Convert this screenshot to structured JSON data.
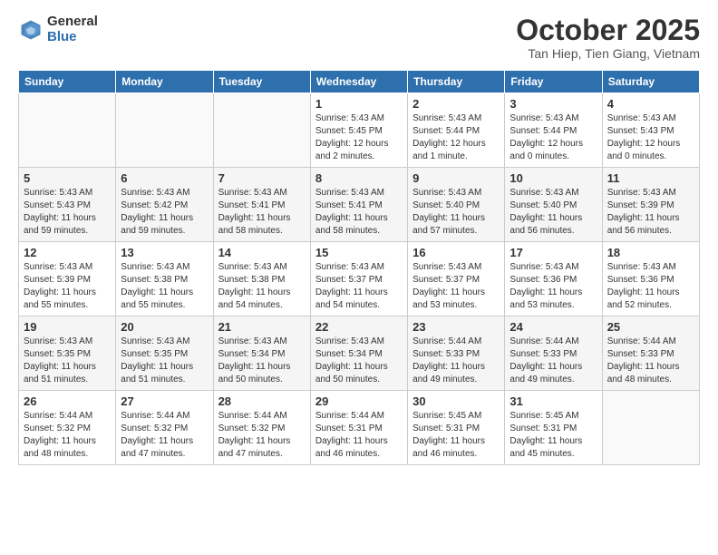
{
  "header": {
    "logo_general": "General",
    "logo_blue": "Blue",
    "month": "October 2025",
    "location": "Tan Hiep, Tien Giang, Vietnam"
  },
  "days_of_week": [
    "Sunday",
    "Monday",
    "Tuesday",
    "Wednesday",
    "Thursday",
    "Friday",
    "Saturday"
  ],
  "weeks": [
    [
      {
        "day": "",
        "text": ""
      },
      {
        "day": "",
        "text": ""
      },
      {
        "day": "",
        "text": ""
      },
      {
        "day": "1",
        "text": "Sunrise: 5:43 AM\nSunset: 5:45 PM\nDaylight: 12 hours\nand 2 minutes."
      },
      {
        "day": "2",
        "text": "Sunrise: 5:43 AM\nSunset: 5:44 PM\nDaylight: 12 hours\nand 1 minute."
      },
      {
        "day": "3",
        "text": "Sunrise: 5:43 AM\nSunset: 5:44 PM\nDaylight: 12 hours\nand 0 minutes."
      },
      {
        "day": "4",
        "text": "Sunrise: 5:43 AM\nSunset: 5:43 PM\nDaylight: 12 hours\nand 0 minutes."
      }
    ],
    [
      {
        "day": "5",
        "text": "Sunrise: 5:43 AM\nSunset: 5:43 PM\nDaylight: 11 hours\nand 59 minutes."
      },
      {
        "day": "6",
        "text": "Sunrise: 5:43 AM\nSunset: 5:42 PM\nDaylight: 11 hours\nand 59 minutes."
      },
      {
        "day": "7",
        "text": "Sunrise: 5:43 AM\nSunset: 5:41 PM\nDaylight: 11 hours\nand 58 minutes."
      },
      {
        "day": "8",
        "text": "Sunrise: 5:43 AM\nSunset: 5:41 PM\nDaylight: 11 hours\nand 58 minutes."
      },
      {
        "day": "9",
        "text": "Sunrise: 5:43 AM\nSunset: 5:40 PM\nDaylight: 11 hours\nand 57 minutes."
      },
      {
        "day": "10",
        "text": "Sunrise: 5:43 AM\nSunset: 5:40 PM\nDaylight: 11 hours\nand 56 minutes."
      },
      {
        "day": "11",
        "text": "Sunrise: 5:43 AM\nSunset: 5:39 PM\nDaylight: 11 hours\nand 56 minutes."
      }
    ],
    [
      {
        "day": "12",
        "text": "Sunrise: 5:43 AM\nSunset: 5:39 PM\nDaylight: 11 hours\nand 55 minutes."
      },
      {
        "day": "13",
        "text": "Sunrise: 5:43 AM\nSunset: 5:38 PM\nDaylight: 11 hours\nand 55 minutes."
      },
      {
        "day": "14",
        "text": "Sunrise: 5:43 AM\nSunset: 5:38 PM\nDaylight: 11 hours\nand 54 minutes."
      },
      {
        "day": "15",
        "text": "Sunrise: 5:43 AM\nSunset: 5:37 PM\nDaylight: 11 hours\nand 54 minutes."
      },
      {
        "day": "16",
        "text": "Sunrise: 5:43 AM\nSunset: 5:37 PM\nDaylight: 11 hours\nand 53 minutes."
      },
      {
        "day": "17",
        "text": "Sunrise: 5:43 AM\nSunset: 5:36 PM\nDaylight: 11 hours\nand 53 minutes."
      },
      {
        "day": "18",
        "text": "Sunrise: 5:43 AM\nSunset: 5:36 PM\nDaylight: 11 hours\nand 52 minutes."
      }
    ],
    [
      {
        "day": "19",
        "text": "Sunrise: 5:43 AM\nSunset: 5:35 PM\nDaylight: 11 hours\nand 51 minutes."
      },
      {
        "day": "20",
        "text": "Sunrise: 5:43 AM\nSunset: 5:35 PM\nDaylight: 11 hours\nand 51 minutes."
      },
      {
        "day": "21",
        "text": "Sunrise: 5:43 AM\nSunset: 5:34 PM\nDaylight: 11 hours\nand 50 minutes."
      },
      {
        "day": "22",
        "text": "Sunrise: 5:43 AM\nSunset: 5:34 PM\nDaylight: 11 hours\nand 50 minutes."
      },
      {
        "day": "23",
        "text": "Sunrise: 5:44 AM\nSunset: 5:33 PM\nDaylight: 11 hours\nand 49 minutes."
      },
      {
        "day": "24",
        "text": "Sunrise: 5:44 AM\nSunset: 5:33 PM\nDaylight: 11 hours\nand 49 minutes."
      },
      {
        "day": "25",
        "text": "Sunrise: 5:44 AM\nSunset: 5:33 PM\nDaylight: 11 hours\nand 48 minutes."
      }
    ],
    [
      {
        "day": "26",
        "text": "Sunrise: 5:44 AM\nSunset: 5:32 PM\nDaylight: 11 hours\nand 48 minutes."
      },
      {
        "day": "27",
        "text": "Sunrise: 5:44 AM\nSunset: 5:32 PM\nDaylight: 11 hours\nand 47 minutes."
      },
      {
        "day": "28",
        "text": "Sunrise: 5:44 AM\nSunset: 5:32 PM\nDaylight: 11 hours\nand 47 minutes."
      },
      {
        "day": "29",
        "text": "Sunrise: 5:44 AM\nSunset: 5:31 PM\nDaylight: 11 hours\nand 46 minutes."
      },
      {
        "day": "30",
        "text": "Sunrise: 5:45 AM\nSunset: 5:31 PM\nDaylight: 11 hours\nand 46 minutes."
      },
      {
        "day": "31",
        "text": "Sunrise: 5:45 AM\nSunset: 5:31 PM\nDaylight: 11 hours\nand 45 minutes."
      },
      {
        "day": "",
        "text": ""
      }
    ]
  ]
}
